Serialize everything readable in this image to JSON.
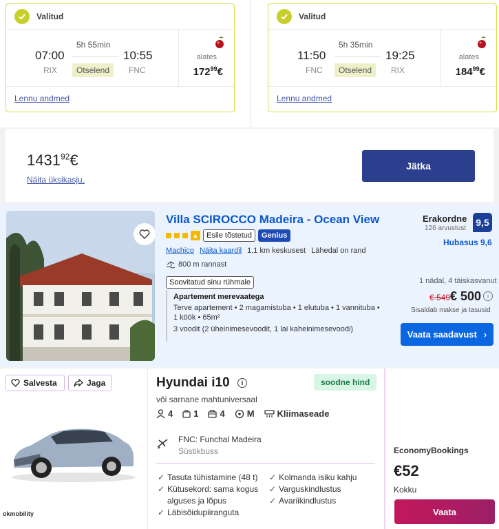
{
  "flights": [
    {
      "selected_label": "Valitud",
      "dep_time": "07:00",
      "arr_time": "10:55",
      "dep_code": "RIX",
      "arr_code": "FNC",
      "duration": "5h 55min",
      "direct": "Otselend",
      "from_label": "alates",
      "price_main": "172",
      "price_cents": "99",
      "currency": "€",
      "details_link": "Lennu andmed"
    },
    {
      "selected_label": "Valitud",
      "dep_time": "11:50",
      "arr_time": "19:25",
      "dep_code": "FNC",
      "arr_code": "RIX",
      "duration": "5h 35min",
      "direct": "Otselend",
      "from_label": "alates",
      "price_main": "184",
      "price_cents": "99",
      "currency": "€",
      "details_link": "Lennu andmed"
    }
  ],
  "summary": {
    "total_main": "1431",
    "total_cents": "92",
    "currency": "€",
    "single_price_link": "Näita üksikasju.",
    "continue_label": "Jätka"
  },
  "hotel": {
    "name": "Villa SCIROCCO Madeira - Ocean View",
    "promoted": "Esile tõstetud",
    "genius": "Genius",
    "location": "Machico",
    "map_link": "Näita kaardil",
    "distance": "1,1 km keskusest",
    "near_beach": "Lähedal on rand",
    "beach_distance": "800 m rannast",
    "group_tag": "Soovitatud sinu rühmale",
    "apt_title": "Apartement merevaatega",
    "apt_line1": "Terve apartement • 2 magamistuba • 1 elutuba • 1 vannituba •",
    "apt_line2": "1 köök • 65m²",
    "apt_line3": "3 voodit (2 üheinimesevoodit, 1 lai kaheinimesevoodi)",
    "rating_word": "Erakordne",
    "reviews": "126 arvustust",
    "score": "9,5",
    "cleanliness": "Hubasus 9,6",
    "stay_length": "1 nädal, 4 täiskasvanut",
    "old_price": "€ 549",
    "new_price": "€ 500",
    "taxes": "Sisaldab makse ja tasusid",
    "availability_label": "Vaata saadavust",
    "info_glyph": "i",
    "stars": 3
  },
  "car": {
    "save_label": "Salvesta",
    "share_label": "Jaga",
    "name": "Hyundai i10",
    "info_glyph": "i",
    "good_price": "soodne hind",
    "similar": "või sarnane mahtuniversaal",
    "seats": "4",
    "bags_small": "1",
    "bags_large": "4",
    "transmission": "M",
    "ac": "Kliimaseade",
    "pickup": "FNC: Funchal Madeira",
    "shuttle": "Süstikbuss",
    "features_left": [
      "Tasuta tühistamine (48 t)",
      "Kütusekord: sama kogus",
      "alguses ja lõpus",
      "Läbisõidupiiranguta"
    ],
    "features_right": [
      "Kolmanda isiku kahju",
      "Varguskindlustus",
      "Avariikindlustus"
    ],
    "partner": "okmobility",
    "provider": "EconomyBookings",
    "price": "€52",
    "total_label": "Kokku",
    "view_label": "Vaata"
  },
  "colors": {
    "accent_lime": "#c7cf2b",
    "primary_navy": "#2c3f8f",
    "booking_blue": "#0a66e1",
    "car_cta": "#c2185b"
  }
}
